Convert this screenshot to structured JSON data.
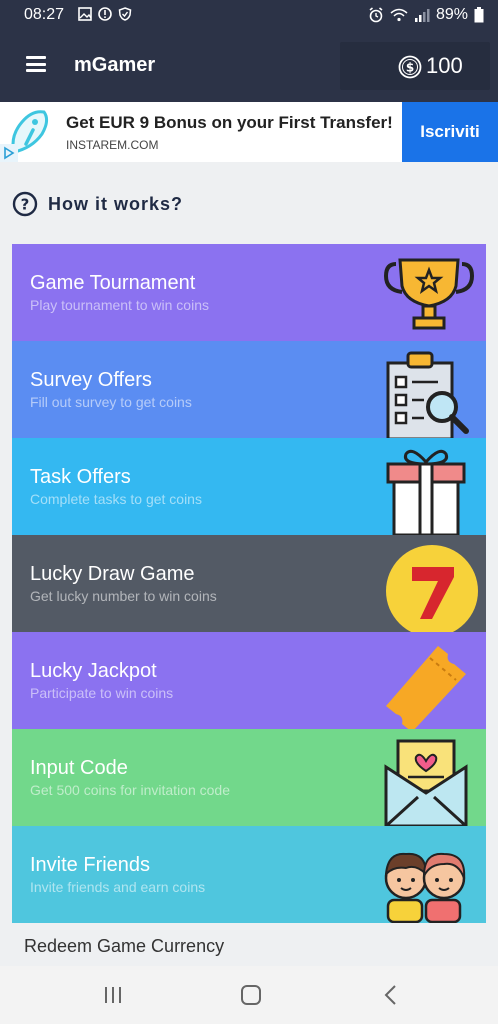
{
  "status": {
    "time": "08:27",
    "battery": "89%"
  },
  "app": {
    "title": "mGamer",
    "coins": "100",
    "icons": {
      "menu": "hamburger-menu-icon",
      "coin": "dollar-coin-icon"
    }
  },
  "ad": {
    "title": "Get EUR 9 Bonus on your First Transfer!",
    "url": "INSTAREM.COM",
    "cta": "Iscriviti",
    "accent": "#1a73e8"
  },
  "how": {
    "label": "How it works?"
  },
  "cards": [
    {
      "title": "Game Tournament",
      "subtitle": "Play tournament to win coins",
      "color": "#8b72f0",
      "icon": "trophy-icon"
    },
    {
      "title": "Survey Offers",
      "subtitle": "Fill out survey to get coins",
      "color": "#5b8df2",
      "icon": "survey-clipboard-icon"
    },
    {
      "title": "Task Offers",
      "subtitle": "Complete tasks to get coins",
      "color": "#34b8f1",
      "icon": "gift-icon"
    },
    {
      "title": "Lucky Draw Game",
      "subtitle": "Get lucky number to win coins",
      "color": "#535a65",
      "icon": "lucky-seven-icon"
    },
    {
      "title": "Lucky Jackpot",
      "subtitle": "Participate to win coins",
      "color": "#8b72f0",
      "icon": "ticket-icon"
    },
    {
      "title": "Input Code",
      "subtitle": "Get 500 coins for invitation code",
      "color": "#72d88b",
      "icon": "invitation-envelope-icon"
    },
    {
      "title": "Invite Friends",
      "subtitle": "Invite friends and earn coins",
      "color": "#4fc6de",
      "icon": "friends-icon"
    }
  ],
  "redeem": {
    "label": "Redeem Game Currency"
  }
}
